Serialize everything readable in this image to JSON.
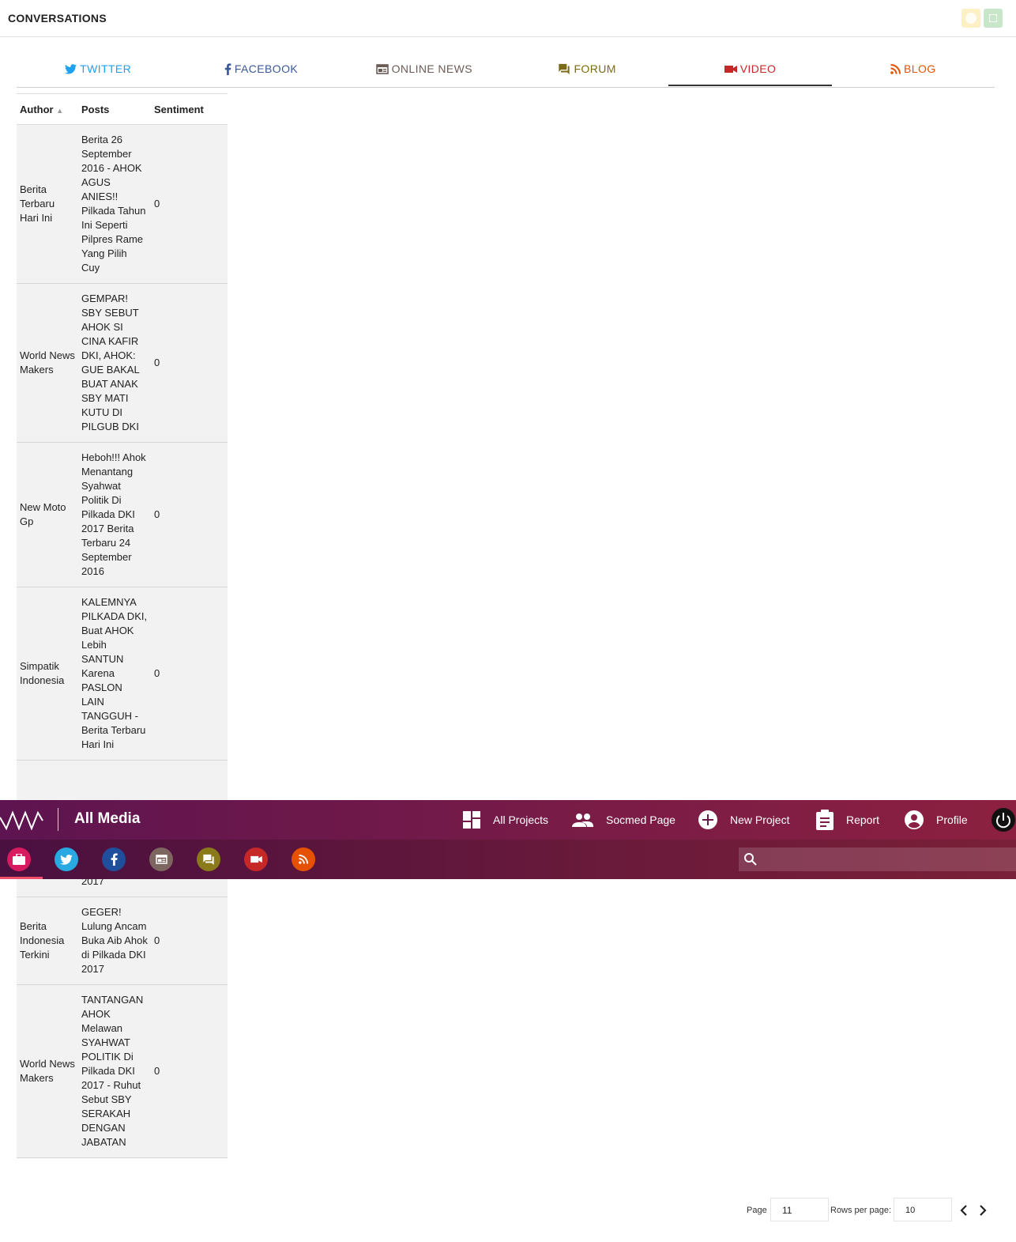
{
  "header": {
    "title": "CONVERSATIONS"
  },
  "tabs": [
    {
      "label": "TWITTER",
      "color": "#1da1f2"
    },
    {
      "label": "FACEBOOK",
      "color": "#3b5998"
    },
    {
      "label": "ONLINE NEWS",
      "color": "#6d5c55"
    },
    {
      "label": "FORUM",
      "color": "#7a6b14"
    },
    {
      "label": "VIDEO",
      "color": "#c62828",
      "active": true
    },
    {
      "label": "BLOG",
      "color": "#e65100"
    }
  ],
  "table": {
    "columns": {
      "author": "Author",
      "posts": "Posts",
      "sentiment": "Sentiment"
    },
    "rows_top": [
      {
        "author": "Berita Terbaru Hari Ini",
        "post": "Berita 26 September 2016 - AHOK AGUS ANIES!! Pilkada Tahun Ini Seperti Pilpres Rame Yang Pilih Cuy",
        "sentiment": "0"
      },
      {
        "author": "World News Makers",
        "post": "GEMPAR! SBY SEBUT AHOK SI CINA KAFIR DKI, AHOK: GUE BAKAL BUAT ANAK SBY MATI KUTU DI PILGUB DKI",
        "sentiment": "0"
      },
      {
        "author": "New Moto Gp",
        "post": "Heboh!!! Ahok Menantang Syahwat Politik Di Pilkada DKI 2017 Berita Terbaru 24 September 2016",
        "sentiment": "0"
      },
      {
        "author": "Simpatik Indonesia",
        "post": "KALEMNYA PILKADA DKI, Buat AHOK Lebih SANTUN Karena PASLON LAIN TANGGUH - Berita Terbaru Hari Ini",
        "sentiment": "0"
      }
    ],
    "partial_row_text": "PILKADA DKI 2017",
    "rows_bottom": [
      {
        "author": "Berita Indonesia Terkini",
        "post": "GEGER! Lulung Ancam Buka Aib Ahok di Pilkada DKI 2017",
        "sentiment": "0"
      },
      {
        "author": "World News Makers",
        "post": "TANTANGAN AHOK Melawan SYAHWAT POLITIK Di Pilkada DKI 2017 - Ruhut Sebut SBY SERAKAH DENGAN JABATAN",
        "sentiment": "0"
      }
    ]
  },
  "navbar": {
    "brand": "All Media",
    "items": [
      "All Projects",
      "Socmed Page",
      "New Project",
      "Report",
      "Profile"
    ],
    "channels": [
      {
        "name": "briefcase-icon",
        "color": "#d81b60"
      },
      {
        "name": "twitter-icon",
        "color": "#29a9e1"
      },
      {
        "name": "facebook-icon",
        "color": "#1f4e9c"
      },
      {
        "name": "news-icon",
        "color": "#7d6660"
      },
      {
        "name": "forum-icon",
        "color": "#8a7a1a"
      },
      {
        "name": "video-icon",
        "color": "#c62828"
      },
      {
        "name": "rss-icon",
        "color": "#e65100"
      }
    ],
    "search_placeholder": ""
  },
  "pagination": {
    "page_label": "Page",
    "page": "11",
    "rows_label": "Rows per page:",
    "rows": "10"
  }
}
